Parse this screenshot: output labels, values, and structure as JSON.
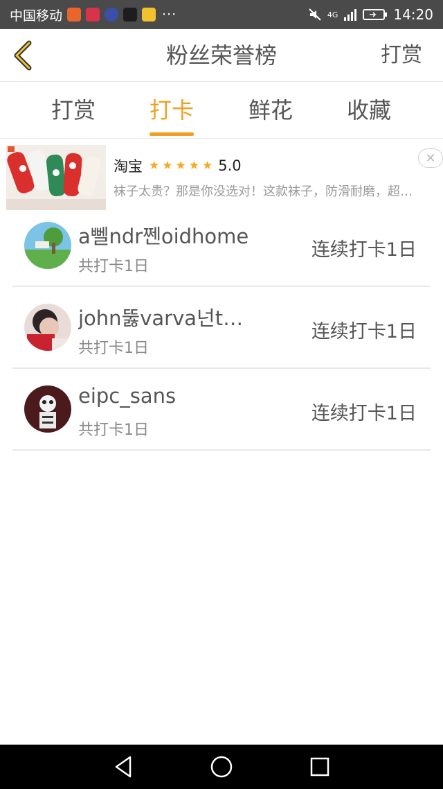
{
  "status_bar": {
    "carrier": "中国移动",
    "dots": "···",
    "network": "4G",
    "time": "14:20"
  },
  "nav": {
    "title": "粉丝荣誉榜",
    "action": "打赏"
  },
  "tabs": [
    {
      "label": "打赏",
      "active": false
    },
    {
      "label": "打卡",
      "active": true
    },
    {
      "label": "鲜花",
      "active": false
    },
    {
      "label": "收藏",
      "active": false
    }
  ],
  "ad": {
    "source": "淘宝",
    "rating": "5.0",
    "stars": 5,
    "description": "袜子太贵？那是你没选对！这款袜子，防滑耐磨，超级可爱",
    "close_symbol": "✕"
  },
  "users": [
    {
      "name": "a뻴ndr쩬oidhome",
      "total": "共打卡1日",
      "streak": "连续打卡1日"
    },
    {
      "name": "john뚫varva넌twitch",
      "total": "共打卡1日",
      "streak": "连续打卡1日"
    },
    {
      "name": "eipc_sans",
      "total": "共打卡1日",
      "streak": "连续打卡1日"
    }
  ],
  "colors": {
    "accent": "#f0a020",
    "status_bar": "#4a4a4a",
    "star": "#f3ab25"
  }
}
